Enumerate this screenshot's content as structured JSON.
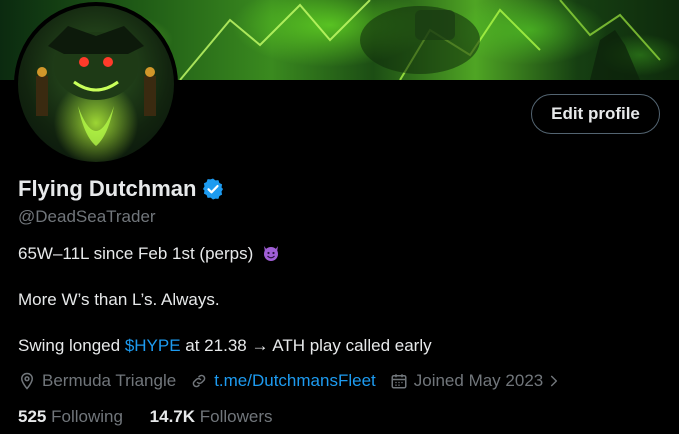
{
  "profile": {
    "name": "Flying Dutchman",
    "handle": "@DeadSeaTrader",
    "verified": true,
    "edit_button": "Edit profile",
    "bio_line1": "65W–11L since Feb 1st (perps)",
    "bio_line2": "More W’s than L’s. Always.",
    "bio_line3_pre": "Swing longed ",
    "bio_line3_link": "$HYPE",
    "bio_line3_post": " at 21.38 → ATH play called early",
    "location": "Bermuda Triangle",
    "website": "t.me/DutchmansFleet",
    "joined": "Joined May 2023",
    "following_count": "525",
    "following_label": "Following",
    "followers_count": "14.7K",
    "followers_label": "Followers"
  },
  "icons": {
    "verified": "verified-badge-icon",
    "devil": "smiling-devil-emoji",
    "location": "location-pin-icon",
    "link": "link-icon",
    "calendar": "calendar-icon",
    "chevron": "chevron-right-icon"
  },
  "colors": {
    "background": "#000000",
    "text": "#e7e9ea",
    "secondary": "#71767b",
    "accent": "#1d9bf0",
    "button_border": "#536471"
  }
}
